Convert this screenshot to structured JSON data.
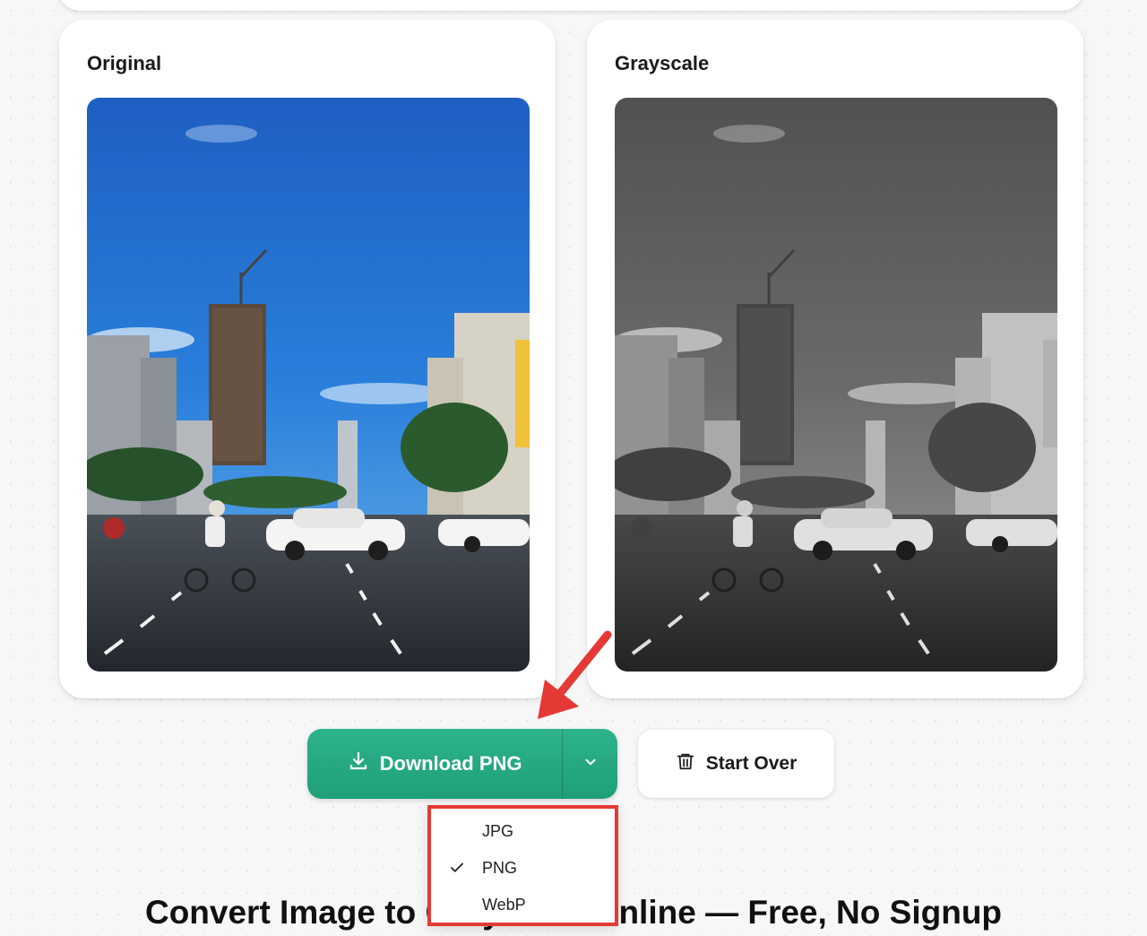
{
  "panels": {
    "original_title": "Original",
    "grayscale_title": "Grayscale"
  },
  "actions": {
    "download_label": "Download PNG",
    "start_over_label": "Start Over"
  },
  "format_menu": {
    "items": [
      {
        "label": "JPG",
        "selected": false
      },
      {
        "label": "PNG",
        "selected": true
      },
      {
        "label": "WebP",
        "selected": false
      }
    ]
  },
  "page": {
    "heading": "Convert Image to Grayscale Online — Free, No Signup"
  },
  "icons": {
    "download": "download-icon",
    "chevron": "chevron-down-icon",
    "trash": "trash-icon",
    "check": "check-icon"
  },
  "colors": {
    "accent": "#22a981",
    "highlight_box": "#e53935",
    "annotation_arrow": "#e53935"
  }
}
